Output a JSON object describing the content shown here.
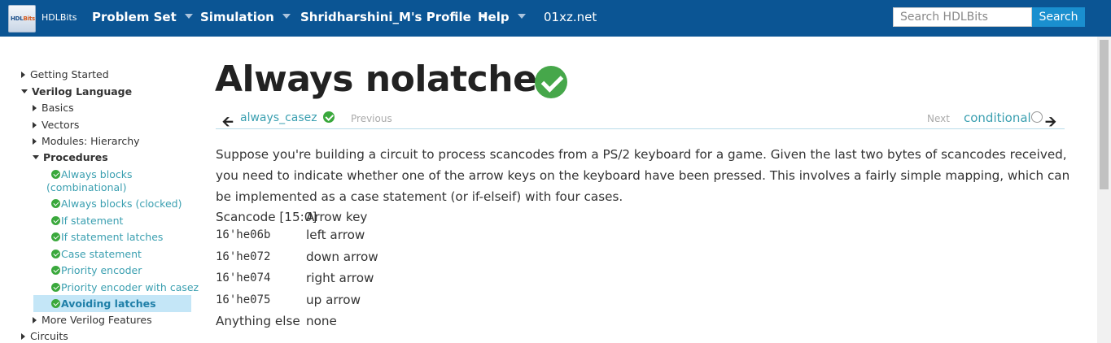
{
  "navbar": {
    "brand": "HDLBits",
    "logo_text_a": "HDL",
    "logo_text_b": "Bits",
    "menu": [
      {
        "label": "Problem Set"
      },
      {
        "label": "Simulation"
      },
      {
        "label": "Shridharshini_M's Profile"
      },
      {
        "label": "Help"
      },
      {
        "label": "01xz.net"
      }
    ],
    "search_placeholder": "Search HDLBits",
    "search_button": "Search",
    "colors": {
      "bar": "#0b5594",
      "search_button": "#1a8fcf"
    }
  },
  "sidebar": {
    "items": [
      {
        "label": "Getting Started"
      },
      {
        "label": "Verilog Language"
      },
      {
        "label": "Basics"
      },
      {
        "label": "Vectors"
      },
      {
        "label": "Modules: Hierarchy"
      },
      {
        "label": "Procedures"
      },
      {
        "label": "Always blocks"
      },
      {
        "label": "(combinational)"
      },
      {
        "label": "Always blocks (clocked)"
      },
      {
        "label": "If statement"
      },
      {
        "label": "If statement latches"
      },
      {
        "label": "Case statement"
      },
      {
        "label": "Priority encoder"
      },
      {
        "label": "Priority encoder with casez"
      },
      {
        "label": "Avoiding latches"
      },
      {
        "label": "More Verilog Features"
      },
      {
        "label": "Circuits"
      }
    ]
  },
  "page": {
    "title": "Always nolatches",
    "status_icon": "check-circle-icon",
    "prev_link": "always_casez",
    "prev_label": "Previous",
    "next_label": "Next",
    "next_link": "conditional",
    "description": "Suppose you're building a circuit to process scancodes from a PS/2 keyboard for a game. Given the last two bytes of scancodes received, you need to indicate whether one of the arrow keys on the keyboard have been pressed. This involves a fairly simple mapping, which can be implemented as a case statement (or if-elseif) with four cases.",
    "table": {
      "headers": [
        "Scancode [15:0]",
        "Arrow key"
      ],
      "rows": [
        [
          "16'he06b",
          "left arrow"
        ],
        [
          "16'he072",
          "down arrow"
        ],
        [
          "16'he074",
          "right arrow"
        ],
        [
          "16'he075",
          "up arrow"
        ],
        [
          "Anything else",
          "none"
        ]
      ]
    }
  }
}
